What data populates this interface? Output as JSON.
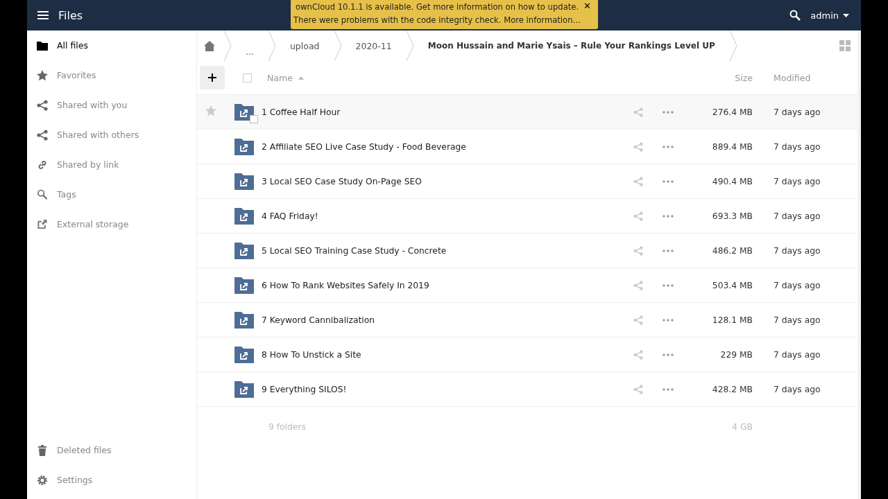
{
  "header": {
    "app_title": "Files",
    "user": "admin"
  },
  "notification": {
    "lines": [
      "ownCloud 10.1.1 is available. Get more information on how to update.",
      "There were problems with the code integrity check. More information…"
    ],
    "close": "✕"
  },
  "sidebar": {
    "items": [
      {
        "label": "All files",
        "kind": "folder",
        "selected": true
      },
      {
        "label": "Favorites",
        "kind": "star",
        "selected": false
      },
      {
        "label": "Shared with you",
        "kind": "share",
        "selected": false
      },
      {
        "label": "Shared with others",
        "kind": "share",
        "selected": false
      },
      {
        "label": "Shared by link",
        "kind": "link",
        "selected": false
      },
      {
        "label": "Tags",
        "kind": "search",
        "selected": false
      },
      {
        "label": "External storage",
        "kind": "external",
        "selected": false
      }
    ],
    "bottom": [
      {
        "label": "Deleted files",
        "kind": "trash"
      },
      {
        "label": "Settings",
        "kind": "gear"
      }
    ]
  },
  "breadcrumb": [
    "...",
    "upload",
    "2020-11",
    "Moon Hussain and Marie Ysais – Rule Your Rankings Level UP"
  ],
  "table": {
    "columns": [
      "Name",
      "Size",
      "Modified"
    ],
    "select_all": {
      "checked": false
    },
    "rows": [
      {
        "name": "1 Coffee Half Hour",
        "size": "276.4 MB",
        "modified": "7 days ago",
        "highlighted": true
      },
      {
        "name": "2 Affiliate SEO Live Case Study - Food Beverage",
        "size": "889.4 MB",
        "modified": "7 days ago",
        "highlighted": false
      },
      {
        "name": "3 Local SEO Case Study On-Page SEO",
        "size": "490.4 MB",
        "modified": "7 days ago",
        "highlighted": false
      },
      {
        "name": "4 FAQ Friday!",
        "size": "693.3 MB",
        "modified": "7 days ago",
        "highlighted": false
      },
      {
        "name": "5 Local SEO Training Case Study - Concrete",
        "size": "486.2 MB",
        "modified": "7 days ago",
        "highlighted": false
      },
      {
        "name": "6 How To Rank Websites Safely In 2019",
        "size": "503.4 MB",
        "modified": "7 days ago",
        "highlighted": false
      },
      {
        "name": "7 Keyword Cannibalization",
        "size": "128.1 MB",
        "modified": "7 days ago",
        "highlighted": false
      },
      {
        "name": "8 How To Unstick a Site",
        "size": "229 MB",
        "modified": "7 days ago",
        "highlighted": false
      },
      {
        "name": "9 Everything SILOS!",
        "size": "428.2 MB",
        "modified": "7 days ago",
        "highlighted": false
      }
    ],
    "summary": {
      "count": "9 folders",
      "size": "4 GB"
    }
  }
}
